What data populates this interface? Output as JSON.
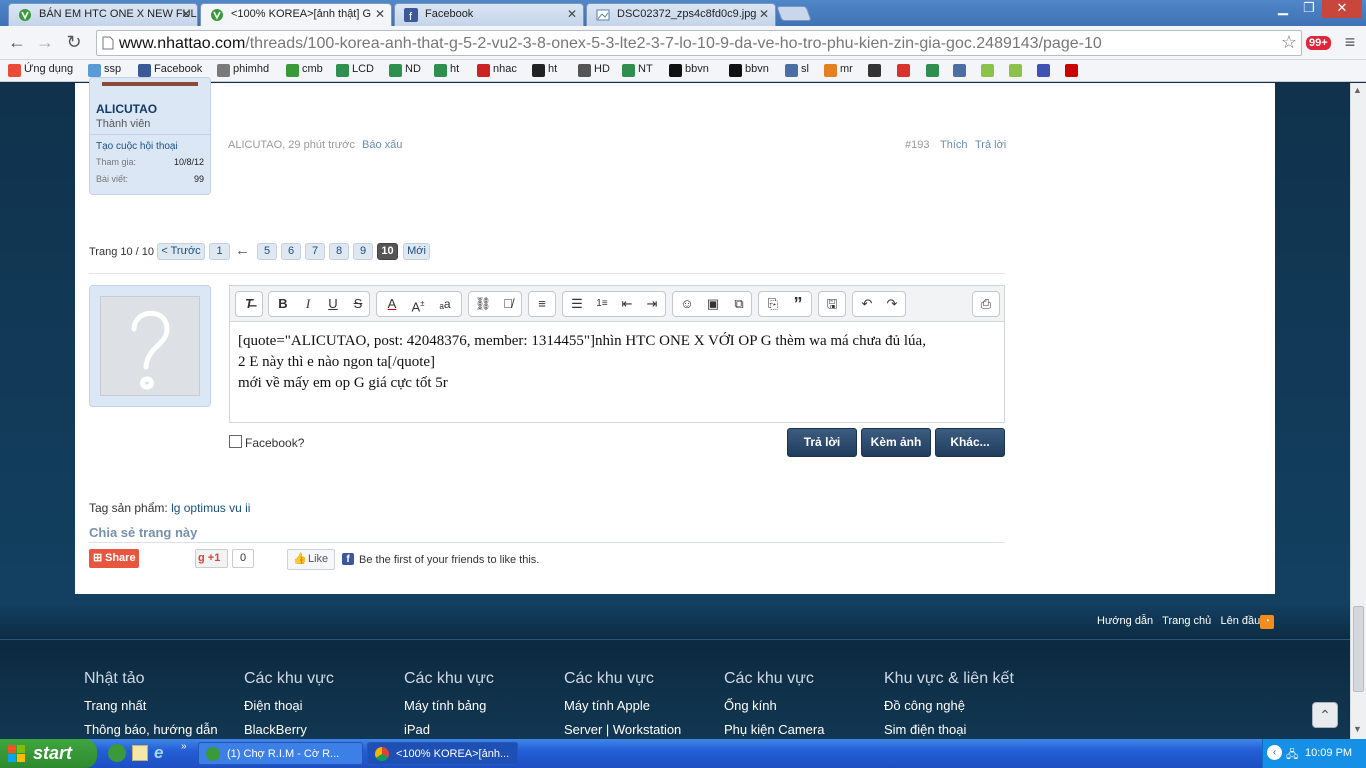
{
  "browser": {
    "tabs": [
      {
        "title": "BÁN EM HTC ONE X NEW FUL",
        "active": false
      },
      {
        "title": "<100% KOREA>[ảnh thật] G",
        "active": true
      },
      {
        "title": "Facebook",
        "active": false
      },
      {
        "title": "DSC02372_zps4c8fd0c9.jpg",
        "active": false
      }
    ],
    "url_domain": "www.nhattao.com",
    "url_path": "/threads/100-korea-anh-that-g-5-2-vu2-3-8-onex-5-3-lte2-3-7-lo-10-9-da-ve-ho-tro-phu-kien-zin-gia-goc.2489143/page-10",
    "extension_badge": "99+",
    "bookmarks": [
      {
        "label": "Ứng dụng",
        "color": "#e94b35"
      },
      {
        "label": "ssp",
        "color": "#5b9bd5"
      },
      {
        "label": "Facebook",
        "color": "#3b5998"
      },
      {
        "label": "phimhd",
        "color": "#7a7a7a"
      },
      {
        "label": "cmb",
        "color": "#3a9a3a"
      },
      {
        "label": "LCD",
        "color": "#2f8f4f"
      },
      {
        "label": "ND",
        "color": "#2f8f4f"
      },
      {
        "label": "ht",
        "color": "#2f8f4f"
      },
      {
        "label": "nhac",
        "color": "#cc2222"
      },
      {
        "label": "ht",
        "color": "#222222"
      },
      {
        "label": "HD",
        "color": "#555555"
      },
      {
        "label": "NT",
        "color": "#2f8f4f"
      },
      {
        "label": "bbvn",
        "color": "#111111"
      },
      {
        "label": "bbvn",
        "color": "#111111"
      },
      {
        "label": "sl",
        "color": "#4a6fa5"
      },
      {
        "label": "mr",
        "color": "#e67e22"
      }
    ]
  },
  "post": {
    "username": "ALICUTAO",
    "user_title": "Thành viên",
    "start_conversation": "Tạo cuộc hội thoại",
    "join_label": "Tham gia:",
    "join_value": "10/8/12",
    "posts_label": "Bài viết:",
    "posts_value": "99",
    "meta_author": "ALICUTAO, 29 phút trước",
    "report": "Báo xấu",
    "number": "#193",
    "like": "Thích",
    "reply": "Trả lời"
  },
  "pagination": {
    "label": "Trang 10 / 10",
    "prev": "< Trước",
    "pages": [
      "1",
      "5",
      "6",
      "7",
      "8",
      "9",
      "10"
    ],
    "current": "10",
    "arrow": "←",
    "new": "Mới"
  },
  "editor": {
    "line1": "[quote=\"ALICUTAO, post: 42048376, member: 1314455\"]nhìn HTC ONE X VỚI OP G thèm wa má chưa đủ lúa,",
    "line2": "2 E này thì e nào ngon ta[/quote]",
    "line3": "mới về mấy em op G giá cực tốt 5r",
    "facebook_checkbox": "Facebook?",
    "btn_reply": "Trả lời",
    "btn_attach": "Kèm ảnh",
    "btn_more": "Khác..."
  },
  "tags": {
    "label": "Tag sản phẩm:",
    "value": "lg optimus vu ii"
  },
  "share": {
    "title": "Chia sẻ trang này",
    "share_btn": "Share",
    "gplus": "+1",
    "gplus_count": "0",
    "fb_like": "Like",
    "fb_text": "Be the first of your friends to like this."
  },
  "footer_links": [
    "Hướng dẫn",
    "Trang chủ",
    "Lên đầu"
  ],
  "footer_columns": [
    {
      "title": "Nhật tảo",
      "links": [
        "Trang nhất",
        "Thông báo, hướng dẫn"
      ]
    },
    {
      "title": "Các khu vực",
      "links": [
        "Điện thoại",
        "BlackBerry"
      ]
    },
    {
      "title": "Các khu vực",
      "links": [
        "Máy tính bảng",
        "iPad"
      ]
    },
    {
      "title": "Các khu vực",
      "links": [
        "Máy tính Apple",
        "Server | Workstation"
      ]
    },
    {
      "title": "Các khu vực",
      "links": [
        "Ống kính",
        "Phụ kiện Camera"
      ]
    },
    {
      "title": "Khu vực & liên kết",
      "links": [
        "Đồ công nghệ",
        "Sim điện thoại"
      ]
    }
  ],
  "taskbar": {
    "start": "start",
    "tasks": [
      "(1) Chợ R.I.M - Cờ R...",
      "<100% KOREA>[ảnh..."
    ],
    "clock": "10:09 PM"
  }
}
